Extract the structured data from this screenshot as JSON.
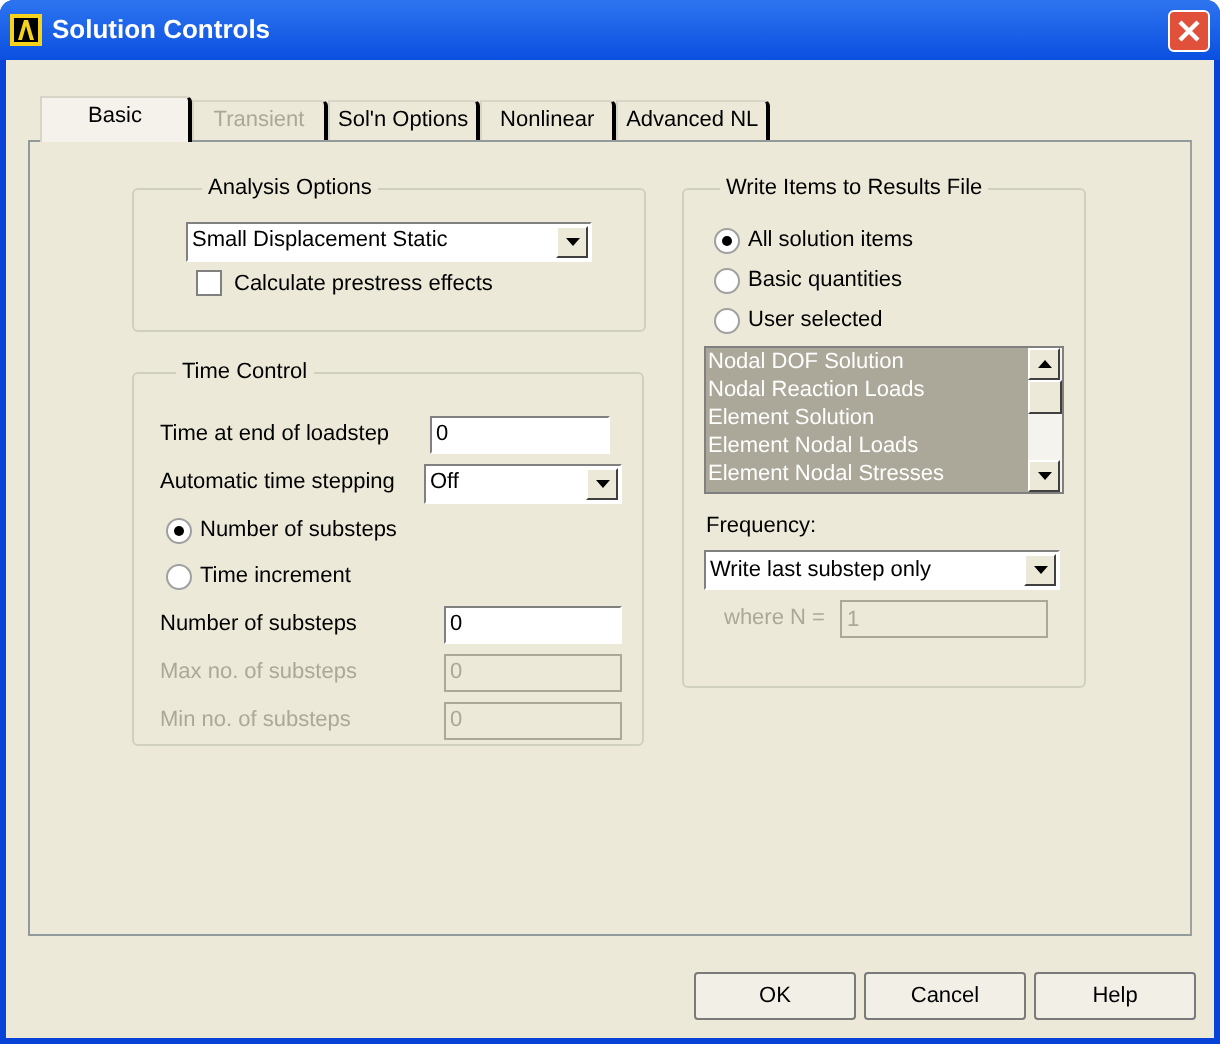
{
  "window": {
    "title": "Solution Controls"
  },
  "tabs": [
    {
      "label": "Basic",
      "selected": true,
      "disabled": false
    },
    {
      "label": "Transient",
      "selected": false,
      "disabled": true
    },
    {
      "label": "Sol'n Options",
      "selected": false,
      "disabled": false
    },
    {
      "label": "Nonlinear",
      "selected": false,
      "disabled": false
    },
    {
      "label": "Advanced NL",
      "selected": false,
      "disabled": false
    }
  ],
  "analysis_options": {
    "title": "Analysis Options",
    "analysis_type": "Small Displacement Static",
    "prestress": {
      "label": "Calculate prestress effects",
      "checked": false
    }
  },
  "time_control": {
    "title": "Time Control",
    "rows": [
      {
        "kind": "field",
        "label": "Time at end of loadstep",
        "value": "0",
        "disabled": false
      },
      {
        "kind": "dropdown",
        "label": "Automatic time stepping",
        "value": "Off"
      },
      {
        "kind": "radio",
        "label": "Number of substeps",
        "selected": true
      },
      {
        "kind": "radio",
        "label": "Time increment",
        "selected": false
      },
      {
        "kind": "field",
        "label": "Number of substeps",
        "value": "0",
        "disabled": false
      },
      {
        "kind": "field",
        "label": "Max no. of substeps",
        "value": "0",
        "disabled": true
      },
      {
        "kind": "field",
        "label": "Min no. of substeps",
        "value": "0",
        "disabled": true
      }
    ]
  },
  "write_items": {
    "title": "Write Items to Results File",
    "options": [
      {
        "label": "All solution items",
        "selected": true
      },
      {
        "label": "Basic quantities",
        "selected": false
      },
      {
        "label": "User selected",
        "selected": false
      }
    ],
    "items": [
      "Nodal DOF Solution",
      "Nodal Reaction Loads",
      "Element Solution",
      "Element Nodal Loads",
      "Element Nodal Stresses"
    ],
    "frequency_label": "Frequency:",
    "frequency": "Write last substep only",
    "where_n": {
      "label": "where N =",
      "value": "1",
      "disabled": true
    }
  },
  "buttons": [
    "OK",
    "Cancel",
    "Help"
  ]
}
